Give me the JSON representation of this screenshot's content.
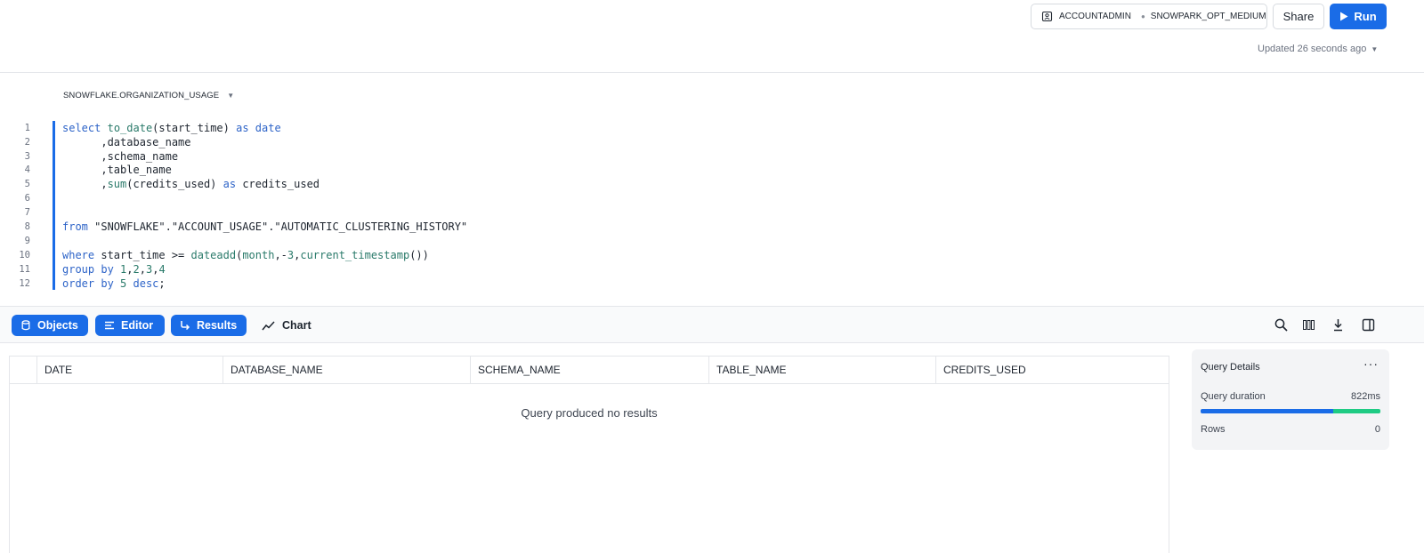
{
  "header": {
    "role": "ACCOUNTADMIN",
    "warehouse": "SNOWPARK_OPT_MEDIUM",
    "share_label": "Share",
    "run_label": "Run",
    "updated_text": "Updated 26 seconds ago"
  },
  "editor": {
    "db_context": "SNOWFLAKE.ORGANIZATION_USAGE",
    "line_numbers": [
      "1",
      "2",
      "3",
      "4",
      "5",
      "6",
      "7",
      "8",
      "9",
      "10",
      "11",
      "12"
    ]
  },
  "tabs": {
    "objects": "Objects",
    "editor": "Editor",
    "results": "Results",
    "chart": "Chart"
  },
  "results": {
    "columns": [
      "DATE",
      "DATABASE_NAME",
      "SCHEMA_NAME",
      "TABLE_NAME",
      "CREDITS_USED"
    ],
    "empty_message": "Query produced no results"
  },
  "query_details": {
    "title": "Query Details",
    "duration_label": "Query duration",
    "duration_value": "822ms",
    "duration_bar_fraction": 0.74,
    "rows_label": "Rows",
    "rows_value": "0"
  },
  "colors": {
    "accent": "#1a6ce7",
    "success": "#1fcb84"
  }
}
